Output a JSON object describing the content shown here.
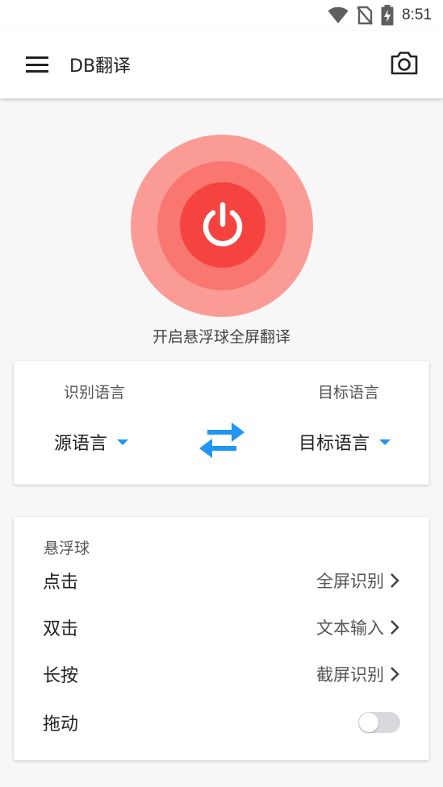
{
  "status_bar": {
    "time": "8:51",
    "icons": [
      "wifi-icon",
      "no-sim-icon",
      "battery-charging-icon"
    ]
  },
  "app_bar": {
    "title": "DB翻译",
    "menu_icon": "hamburger-menu-icon",
    "camera_icon": "camera-icon"
  },
  "power": {
    "caption": "开启悬浮球全屏翻译",
    "icon": "power-icon",
    "colors": {
      "outer": "#fb9b96",
      "mid": "#fa7670",
      "inner": "#f5443f"
    }
  },
  "language": {
    "source_label": "识别语言",
    "target_label": "目标语言",
    "source_value": "源语言",
    "target_value": "目标语言",
    "swap_icon": "swap-arrows-icon",
    "accent": "#2196f3"
  },
  "float_ball": {
    "title": "悬浮球",
    "rows": [
      {
        "label": "点击",
        "value": "全屏识别"
      },
      {
        "label": "双击",
        "value": "文本输入"
      },
      {
        "label": "长按",
        "value": "截屏识别"
      }
    ],
    "drag_label": "拖动",
    "drag_enabled": false
  }
}
